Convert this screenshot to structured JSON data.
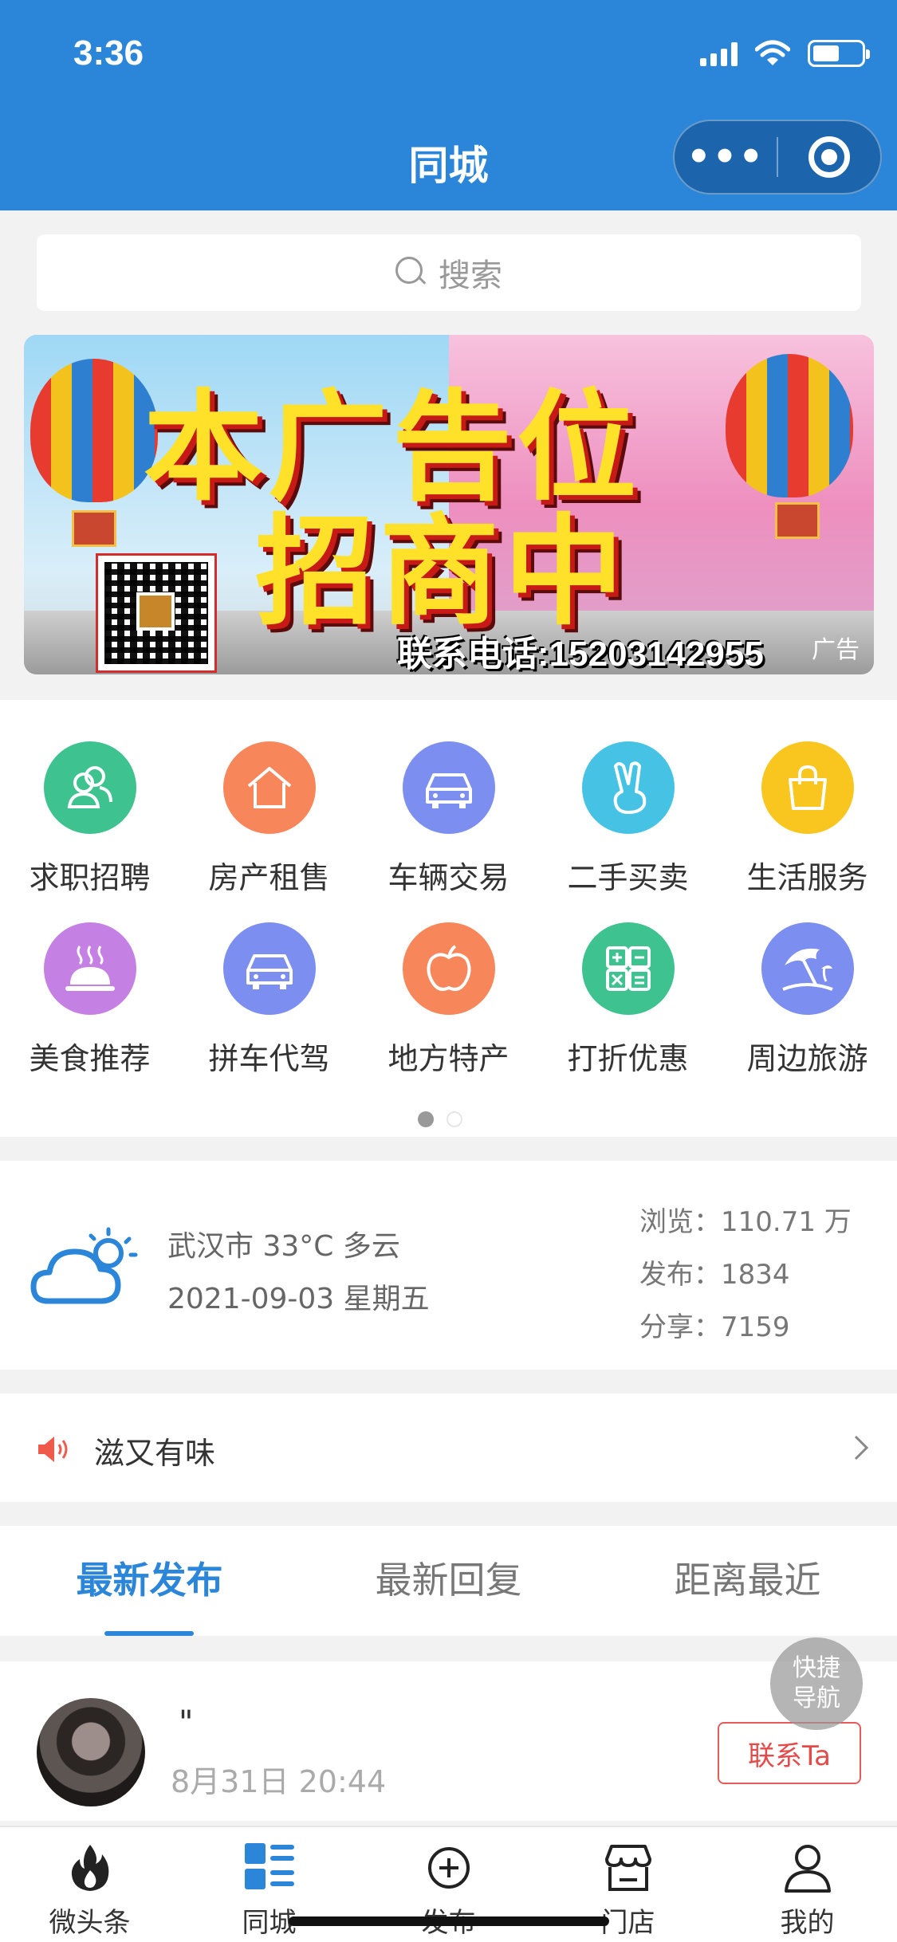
{
  "status_bar": {
    "time": "3:36"
  },
  "header": {
    "title": "同城",
    "more_icon": "more-dots-icon",
    "target_icon": "target-icon"
  },
  "search": {
    "placeholder": "搜索"
  },
  "banner": {
    "line1": "本广告位",
    "line2": "招商中",
    "phone": "联系电话:15203142955",
    "tag": "广告"
  },
  "categories": [
    {
      "label": "求职招聘",
      "icon": "people-icon",
      "color": "#3ec28f"
    },
    {
      "label": "房产租售",
      "icon": "house-icon",
      "color": "#f8865b"
    },
    {
      "label": "车辆交易",
      "icon": "car-icon",
      "color": "#7c8ef0"
    },
    {
      "label": "二手买卖",
      "icon": "victory-hand-icon",
      "color": "#46c3e4"
    },
    {
      "label": "生活服务",
      "icon": "shopping-bag-icon",
      "color": "#f9c61f"
    },
    {
      "label": "美食推荐",
      "icon": "food-cloche-icon",
      "color": "#c481e3"
    },
    {
      "label": "拼车代驾",
      "icon": "car-icon",
      "color": "#7c8ef0"
    },
    {
      "label": "地方特产",
      "icon": "apple-icon",
      "color": "#f8865b"
    },
    {
      "label": "打折优惠",
      "icon": "calculator-icon",
      "color": "#3ec28f"
    },
    {
      "label": "周边旅游",
      "icon": "beach-umbrella-icon",
      "color": "#7c8ef0"
    }
  ],
  "info": {
    "weather_line1": "武汉市 33°C 多云",
    "weather_line2": "2021-09-03 星期五",
    "views": "浏览：110.71 万",
    "posts": "发布：1834",
    "shares": "分享：7159"
  },
  "notice": {
    "text": "滋又有味"
  },
  "tabs": [
    "最新发布",
    "最新回复",
    "距离最近"
  ],
  "post": {
    "title": "\"",
    "time": "8月31日 20:44",
    "contact": "联系Ta"
  },
  "quick_nav": {
    "line1": "快捷",
    "line2": "导航"
  },
  "tabbar": [
    {
      "label": "微头条",
      "icon": "flame-icon"
    },
    {
      "label": "同城",
      "icon": "list-grid-icon"
    },
    {
      "label": "发布",
      "icon": "plus-circle-icon"
    },
    {
      "label": "门店",
      "icon": "store-icon"
    },
    {
      "label": "我的",
      "icon": "user-icon"
    }
  ],
  "colors": {
    "primary": "#2b86da",
    "accent_red": "#e44a4a"
  }
}
